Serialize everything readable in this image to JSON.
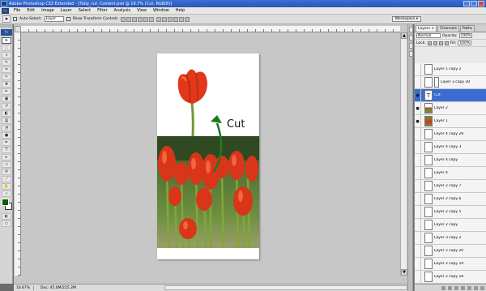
{
  "window": {
    "title": "Adobe Photoshop CS3 Extended - [Tulip_cut_Content.psd @ 16.7% (Cut, RGB/8)]"
  },
  "menu": {
    "badge": "Ps",
    "items": [
      "File",
      "Edit",
      "Image",
      "Layer",
      "Select",
      "Filter",
      "Analysis",
      "View",
      "Window",
      "Help"
    ]
  },
  "options": {
    "tool_icon": "move-tool-icon",
    "auto_select_label": "Auto-Select:",
    "auto_select_value": "Layer",
    "show_transform_label": "Show Transform Controls",
    "workspace_label": "Workspace ▾"
  },
  "toolbox": {
    "badge": "Ps",
    "tools": [
      "move",
      "marquee",
      "lasso",
      "quick-select",
      "crop",
      "slice",
      "healing",
      "brush",
      "stamp",
      "history-brush",
      "eraser",
      "gradient",
      "blur",
      "dodge",
      "pen",
      "type",
      "path-select",
      "shape",
      "notes",
      "eyedropper",
      "hand",
      "zoom"
    ],
    "tool_glyphs": [
      "➤",
      "⬚",
      "ↄ",
      "✎",
      "⌗",
      "✂",
      "✚",
      "✏",
      "▣",
      "↺",
      "◧",
      "▤",
      "◔",
      "●",
      "✒",
      "T",
      "▸",
      "▭",
      "✉",
      "⟋",
      "✋",
      "⌕"
    ],
    "active_tool": "move",
    "foreground_color": "#0c5a0c",
    "background_color": "#ffffff"
  },
  "canvas": {
    "annotation_text": "Cut",
    "arrow_color": "#1f7a1f"
  },
  "status": {
    "zoom": "16.67%",
    "doc_info": "Doc: 45.0M/225.2M"
  },
  "layers_panel": {
    "tabs": [
      "Layers ×",
      "Channels",
      "Paths"
    ],
    "blend_mode": "Normal",
    "opacity_label": "Opacity:",
    "opacity_value": "100%",
    "lock_label": "Lock:",
    "fill_label": "Fill:",
    "fill_value": "100%",
    "layers": [
      {
        "name": "Layer 1 copy 2",
        "visible": false,
        "thumb": "blank",
        "selected": false
      },
      {
        "name": "Layer 3 copy 30",
        "visible": false,
        "thumb": "link",
        "selected": false
      },
      {
        "name": "Cut",
        "visible": true,
        "thumb": "type",
        "selected": true
      },
      {
        "name": "Layer 2",
        "visible": true,
        "thumb": "red",
        "selected": false
      },
      {
        "name": "Layer 1",
        "visible": true,
        "thumb": "photo",
        "selected": false
      },
      {
        "name": "Layer 4 copy 29",
        "visible": false,
        "thumb": "blank",
        "selected": false
      },
      {
        "name": "Layer 4 copy 3",
        "visible": false,
        "thumb": "blank",
        "selected": false
      },
      {
        "name": "Layer 4 copy",
        "visible": false,
        "thumb": "blank",
        "selected": false
      },
      {
        "name": "Layer 4",
        "visible": false,
        "thumb": "blank",
        "selected": false
      },
      {
        "name": "Layer 2 copy 7",
        "visible": false,
        "thumb": "blank",
        "selected": false
      },
      {
        "name": "Layer 2 copy 6",
        "visible": false,
        "thumb": "blank",
        "selected": false
      },
      {
        "name": "Layer 2 copy 5",
        "visible": false,
        "thumb": "blank",
        "selected": false
      },
      {
        "name": "Layer 2 copy",
        "visible": false,
        "thumb": "blank",
        "selected": false
      },
      {
        "name": "Layer 3 copy 2",
        "visible": false,
        "thumb": "blank",
        "selected": false
      },
      {
        "name": "Layer 2 copy 20",
        "visible": false,
        "thumb": "blank",
        "selected": false
      },
      {
        "name": "Layer 2 copy 19",
        "visible": false,
        "thumb": "blank",
        "selected": false
      },
      {
        "name": "Layer 2 copy 18",
        "visible": false,
        "thumb": "blank",
        "selected": false
      }
    ]
  }
}
